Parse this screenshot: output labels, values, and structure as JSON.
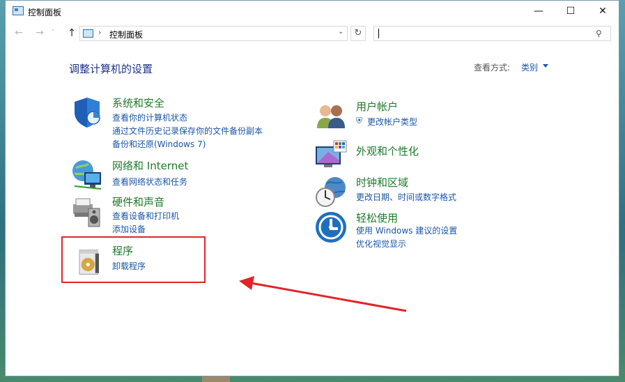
{
  "window": {
    "title": "控制面板"
  },
  "address": {
    "path": "控制面板"
  },
  "search": {
    "placeholder": ""
  },
  "heading": "调整计算机的设置",
  "view": {
    "label": "查看方式:",
    "value": "类别"
  },
  "categories": [
    {
      "title": "系统和安全",
      "icon": "shield-icon",
      "links": [
        "查看你的计算机状态",
        "通过文件历史记录保存你的文件备份副本",
        "备份和还原(Windows 7)"
      ]
    },
    {
      "title": "网络和 Internet",
      "icon": "network-globe-icon",
      "links": [
        "查看网络状态和任务"
      ]
    },
    {
      "title": "硬件和声音",
      "icon": "printer-speaker-icon",
      "links": [
        "查看设备和打印机",
        "添加设备"
      ]
    },
    {
      "title": "程序",
      "icon": "programs-disc-icon",
      "links": [
        "卸载程序"
      ]
    },
    {
      "title": "用户帐户",
      "icon": "users-icon",
      "links": [
        "更改帐户类型"
      ]
    },
    {
      "title": "外观和个性化",
      "icon": "monitor-palette-icon",
      "links": []
    },
    {
      "title": "时钟和区域",
      "icon": "clock-globe-icon",
      "links": [
        "更改日期、时间或数字格式"
      ]
    },
    {
      "title": "轻松使用",
      "icon": "ease-of-access-icon",
      "links": [
        "使用 Windows 建议的设置",
        "优化视觉显示"
      ]
    }
  ],
  "colors": {
    "title_green": "#1e7a2a",
    "link_blue": "#1a56a8",
    "annotation_red": "#e0242a"
  }
}
